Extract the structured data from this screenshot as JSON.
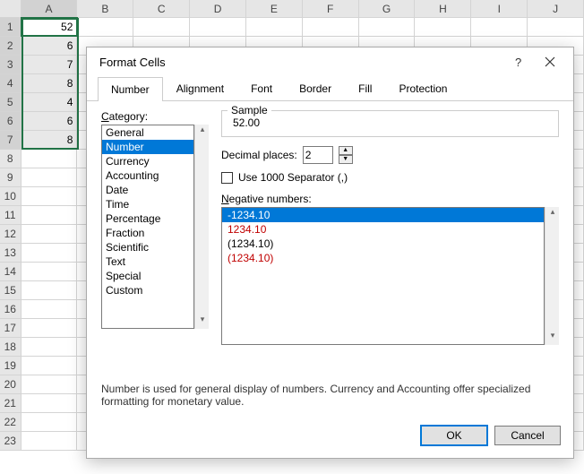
{
  "sheet": {
    "columns": [
      "A",
      "B",
      "C",
      "D",
      "E",
      "F",
      "G",
      "H",
      "I",
      "J"
    ],
    "row_count": 23,
    "selected_col": "A",
    "selected_rows": [
      1,
      2,
      3,
      4,
      5,
      6,
      7
    ],
    "values": {
      "1": "52",
      "2": "6",
      "3": "7",
      "4": "8",
      "5": "4",
      "6": "6",
      "7": "8"
    }
  },
  "dialog": {
    "title": "Format Cells",
    "tabs": [
      "Number",
      "Alignment",
      "Font",
      "Border",
      "Fill",
      "Protection"
    ],
    "active_tab": "Number",
    "category_label": "Category:",
    "categories": [
      "General",
      "Number",
      "Currency",
      "Accounting",
      "Date",
      "Time",
      "Percentage",
      "Fraction",
      "Scientific",
      "Text",
      "Special",
      "Custom"
    ],
    "category_selected": "Number",
    "sample_label": "Sample",
    "sample_value": "52.00",
    "decimal_label": "Decimal places:",
    "decimal_value": "2",
    "separator_label": "Use 1000 Separator (,)",
    "negative_label": "Negative numbers:",
    "negative_options": [
      {
        "text": "-1234.10",
        "red": false,
        "sel": true
      },
      {
        "text": "1234.10",
        "red": true,
        "sel": false
      },
      {
        "text": "(1234.10)",
        "red": false,
        "sel": false
      },
      {
        "text": "(1234.10)",
        "red": true,
        "sel": false
      }
    ],
    "description": "Number is used for general display of numbers.  Currency and Accounting offer specialized formatting for monetary value.",
    "ok": "OK",
    "cancel": "Cancel"
  }
}
